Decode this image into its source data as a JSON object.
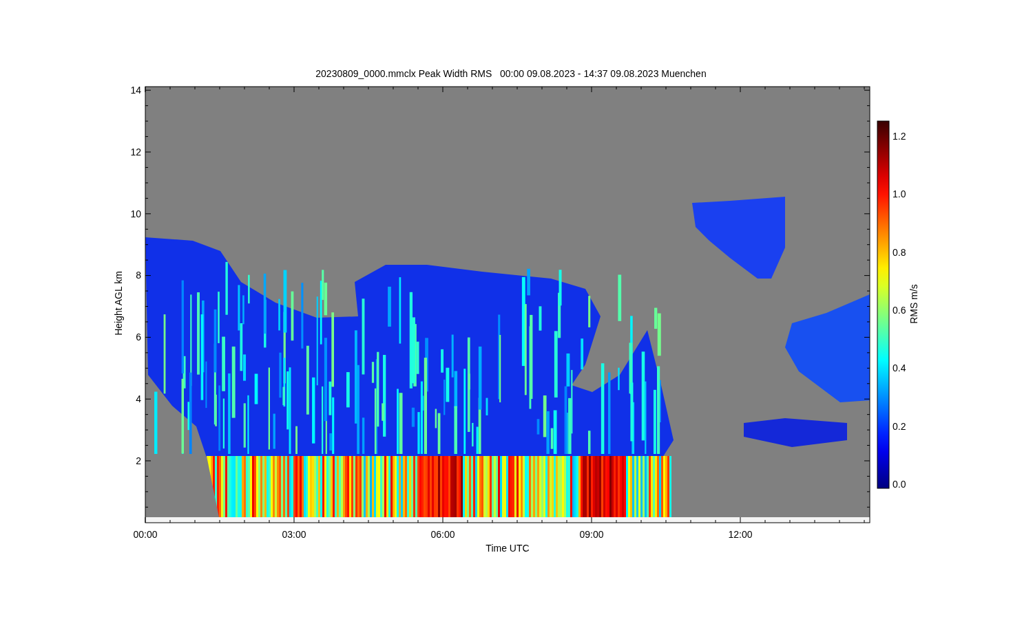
{
  "title": "20230809_0000.mmclx Peak Width RMS   00:00 09.08.2023 - 14:37 09.08.2023 Muenchen",
  "y_axis": {
    "label": "Height AGL km",
    "ticks": [
      "14",
      "12",
      "10",
      "8",
      "6",
      "4",
      "2"
    ]
  },
  "x_axis": {
    "label": "Time UTC",
    "ticks": [
      "00:00",
      "03:00",
      "06:00",
      "09:00",
      "12:00"
    ]
  },
  "colorbar": {
    "label": "RMS m/s",
    "ticks": [
      "1.2",
      "1.0",
      "0.8",
      "0.6",
      "0.4",
      "0.2",
      "0.0"
    ]
  }
}
